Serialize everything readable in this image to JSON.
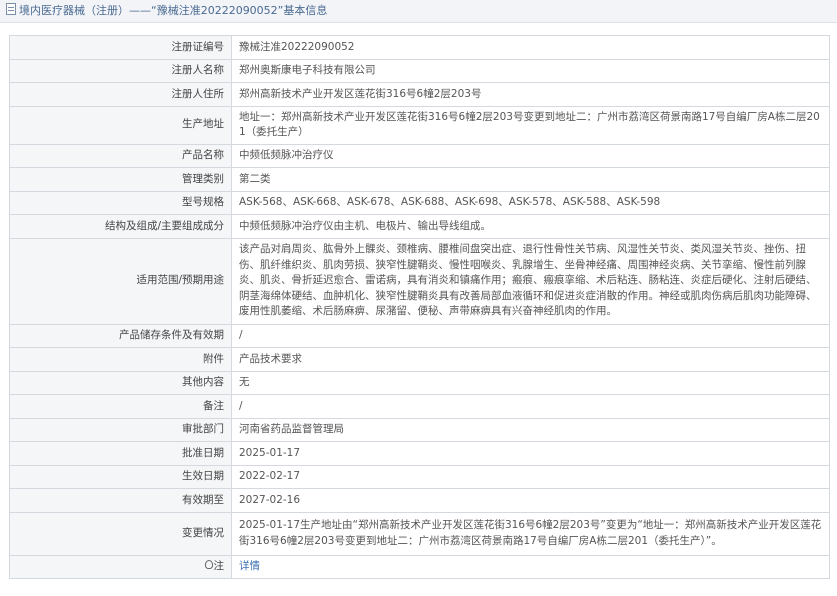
{
  "header": {
    "title": "境内医疗器械（注册）——“豫械注准20222090052”基本信息"
  },
  "rows": [
    {
      "label": "注册证编号",
      "value": "豫械注准20222090052"
    },
    {
      "label": "注册人名称",
      "value": "郑州奥斯康电子科技有限公司"
    },
    {
      "label": "注册人住所",
      "value": "郑州高新技术产业开发区莲花街316号6幢2层203号"
    },
    {
      "label": "生产地址",
      "value": "地址一：郑州高新技术产业开发区莲花街316号6幢2层203号变更到地址二：广州市荔湾区荷景南路17号自编厂房A栋二层201（委托生产）"
    },
    {
      "label": "产品名称",
      "value": "中频低频脉冲治疗仪"
    },
    {
      "label": "管理类别",
      "value": "第二类"
    },
    {
      "label": "型号规格",
      "value": "ASK-568、ASK-668、ASK-678、ASK-688、ASK-698、ASK-578、ASK-588、ASK-598"
    },
    {
      "label": "结构及组成/主要组成成分",
      "value": "中频低频脉冲治疗仪由主机、电极片、输出导线组成。"
    },
    {
      "label": "适用范围/预期用途",
      "value": "该产品对肩周炎、肱骨外上髁炎、颈椎病、腰椎间盘突出症、退行性骨性关节病、风湿性关节炎、类风湿关节炎、挫伤、扭伤、肌纤维织炎、肌肉劳损、狭窄性腱鞘炎、慢性咽喉炎、乳腺增生、坐骨神经痛、周围神经炎病、关节挛缩、慢性前列腺炎、肌炎、骨折延迟愈合、雷诺病，具有消炎和镇痛作用；瘢痕、瘢痕挛缩、术后粘连、肠粘连、炎症后硬化、注射后硬结、阴茎海绵体硬结、血肿机化、狭窄性腱鞘炎具有改善局部血液循环和促进炎症消散的作用。神经或肌肉伤病后肌肉功能障碍、废用性肌萎缩、术后肠麻痹、尿潴留、便秘、声带麻痹具有兴奋神经肌肉的作用。"
    },
    {
      "label": "产品储存条件及有效期",
      "value": "/"
    },
    {
      "label": "附件",
      "value": "产品技术要求"
    },
    {
      "label": "其他内容",
      "value": "无"
    },
    {
      "label": "备注",
      "value": "/"
    },
    {
      "label": "审批部门",
      "value": "河南省药品监督管理局"
    },
    {
      "label": "批准日期",
      "value": "2025-01-17"
    },
    {
      "label": "生效日期",
      "value": "2022-02-17"
    },
    {
      "label": "有效期至",
      "value": "2027-02-16"
    },
    {
      "label": "变更情况",
      "value": "2025-01-17生产地址由“郑州高新技术产业开发区莲花街316号6幢2层203号”变更为“地址一：郑州高新技术产业开发区莲花街316号6幢2层203号变更到地址二：广州市荔湾区荷景南路17号自编厂房A栋二层201（委托生产）”。"
    }
  ],
  "note": {
    "label": "注",
    "link": "详情"
  },
  "colors": {
    "header_bg": "#f2f4f7",
    "label_bg": "#f5f6f8",
    "border": "#d4d9df",
    "link": "#3a6fb0"
  },
  "icons": {
    "header": "document-icon",
    "note": "lightbulb-icon"
  }
}
